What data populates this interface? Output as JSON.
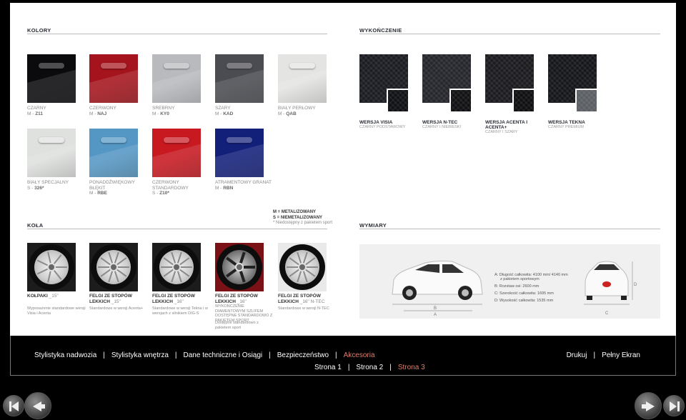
{
  "sections": {
    "colors_title": "KOLORY",
    "finish_title": "WYKOŃCZENIE",
    "wheels_title": "KOŁA",
    "dimensions_title": "WYMIARY"
  },
  "colors": [
    {
      "name": "CZARNY",
      "prefix": "M - ",
      "code": "Z11",
      "hex": "#0b0b0e"
    },
    {
      "name": "CZERWONY",
      "prefix": "M - ",
      "code": "NAJ",
      "hex": "#a5141c"
    },
    {
      "name": "SREBRNY",
      "prefix": "M - ",
      "code": "KY0",
      "hex": "#b8babd"
    },
    {
      "name": "SZARY",
      "prefix": "M - ",
      "code": "KAD",
      "hex": "#4b4c51"
    },
    {
      "name": "BIAŁY PERŁOWY",
      "prefix": "M - ",
      "code": "QAB",
      "hex": "#e4e4e2"
    },
    {
      "name": "BIAŁY SPECJALNY",
      "prefix": "S - ",
      "code": "326*",
      "hex": "#dfe1df"
    },
    {
      "name": "PONADDŹWIĘKOWY BŁĘKIT",
      "prefix": "M - ",
      "code": "RBE",
      "hex": "#5597c4"
    },
    {
      "name": "CZERWONY STANDARDOWY",
      "prefix": "S - ",
      "code": "Z10*",
      "hex": "#c81820"
    },
    {
      "name": "ATRAMENTOWY GRANAT",
      "prefix": "M - ",
      "code": "RBN",
      "hex": "#13207a"
    }
  ],
  "legend": {
    "metallic": "M = METALIZOWANY",
    "non_metallic": "S = NIEMETALIZOWANY",
    "note": "* Niedostępny z pakietem sport"
  },
  "wheels": [
    {
      "title": "KOŁPAKI",
      "size": "_15\"",
      "desc": "Wyposażenie standardowe wersji Visia i Acenta"
    },
    {
      "title": "FELGI ZE STOPÓW LEKKICH",
      "size": "_15\"",
      "desc": "Standardowe w wersji Acenta+"
    },
    {
      "title": "FELGI ZE STOPÓW LEKKICH",
      "size": "_16\"",
      "desc": "Standardowe w wersji Tekna i w wersjach z silnikiem DIG-S"
    },
    {
      "title": "FELGI ZE STOPÓW LEKKICH",
      "size": "_16\"",
      "desc": "WYKOŃCZENIE DIAMENTOWYM SZLIFEM DOSTĘPNE STANDARDOWO Z PAKIETEM SPORT",
      "desc2": "Dostępne standardowo z pakietem sport"
    },
    {
      "title": "FELGI ZE STOPÓW LEKKICH",
      "size": "_16\" N-TEC",
      "desc": "Standardowe w wersji N-TEC"
    }
  ],
  "finishes": [
    {
      "title": "WERSJA VISIA",
      "sub": "CZARNY PODSTAWOWY",
      "main": "#1b1d22",
      "small": "#101114"
    },
    {
      "title": "WERSJA N-TEC",
      "sub": "CZARNY I NIEBIESKI",
      "main": "#25272c",
      "small": "#111114"
    },
    {
      "title": "WERSJA ACENTA I ACENTA+",
      "sub": "CZARNY I SZARY",
      "main": "#1c1c20",
      "small": "#0f0f11"
    },
    {
      "title": "WERSJA TEKNA",
      "sub": "CZARNY PREMIUM",
      "main": "#16171a",
      "small": "#5b5f64"
    }
  ],
  "dimensions": {
    "a": "A: Długość całkowita: 4100 mm/ 4140 mm",
    "a2": "z pakietem sportowym",
    "b": "B: Rozstaw osi: 2600 mm",
    "c": "C: Szerokość całkowita: 1695 mm",
    "d": "D: Wysokość całkowita: 1535 mm",
    "label_a": "A",
    "label_b": "B",
    "label_c": "C",
    "label_d": "D"
  },
  "nav": {
    "items": [
      "Stylistyka nadwozia",
      "Stylistyka wnętrza",
      "Dane techniczne i Osiągi",
      "Bezpieczeństwo",
      "Akcesoria"
    ],
    "right": [
      "Drukuj",
      "Pełny Ekran"
    ],
    "pages": [
      "Strona 1",
      "Strona 2",
      "Strona 3"
    ],
    "active_color": "#e07e6e"
  }
}
